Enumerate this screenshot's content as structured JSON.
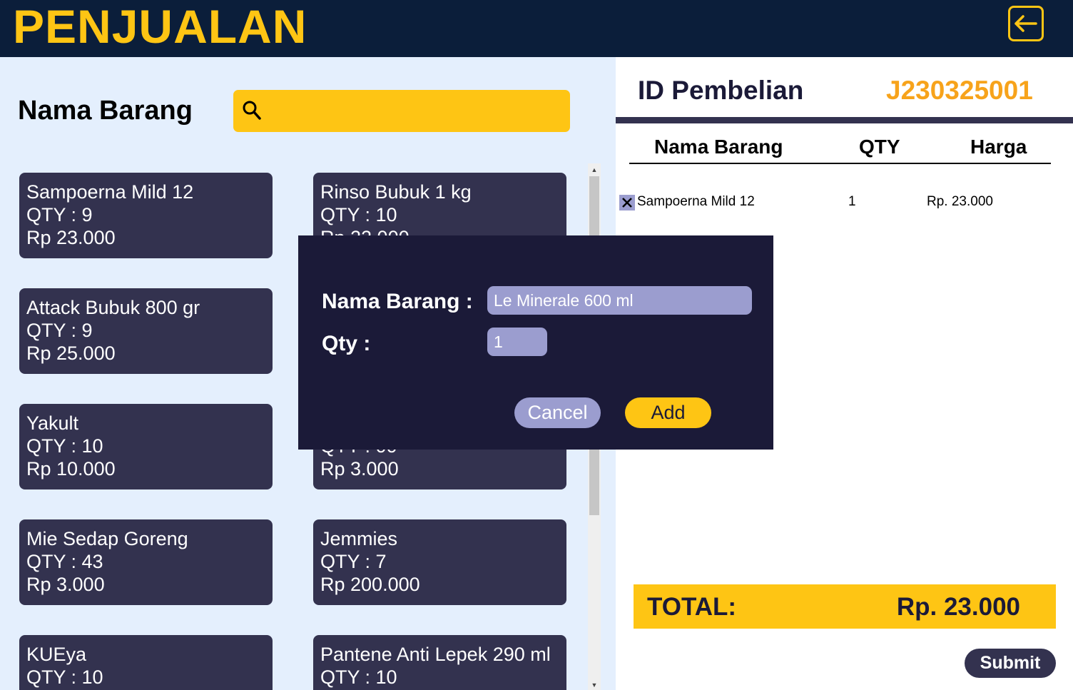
{
  "header": {
    "title": "PENJUALAN",
    "back_icon": "arrow-left-icon"
  },
  "search": {
    "label": "Nama Barang",
    "value": "",
    "placeholder": "",
    "icon": "search-icon"
  },
  "products": [
    {
      "name": "Sampoerna Mild 12",
      "qty": "QTY : 9",
      "price": "Rp 23.000"
    },
    {
      "name": "Rinso Bubuk 1 kg",
      "qty": "QTY : 10",
      "price": "Rp 22.000"
    },
    {
      "name": "Attack Bubuk 800 gr",
      "qty": "QTY : 9",
      "price": "Rp 25.000"
    },
    {
      "name": "",
      "qty": "",
      "price": ""
    },
    {
      "name": "Yakult",
      "qty": "QTY : 10",
      "price": "Rp 10.000"
    },
    {
      "name": "",
      "qty": "QTY : 00",
      "price": "Rp 3.000"
    },
    {
      "name": "Mie Sedap Goreng",
      "qty": "QTY : 43",
      "price": "Rp 3.000"
    },
    {
      "name": "Jemmies",
      "qty": "QTY : 7",
      "price": "Rp 200.000"
    },
    {
      "name": "KUEya",
      "qty": "QTY : 10",
      "price": ""
    },
    {
      "name": "Pantene Anti Lepek 290 ml",
      "qty": "QTY : 10",
      "price": ""
    }
  ],
  "purchase": {
    "id_label": "ID Pembelian",
    "id_value": "J230325001",
    "columns": {
      "name": "Nama Barang",
      "qty": "QTY",
      "price": "Harga"
    },
    "items": [
      {
        "name": "Sampoerna Mild 12",
        "qty": "1",
        "price": "Rp. 23.000"
      }
    ],
    "total_label": "TOTAL:",
    "total_value": "Rp. 23.000",
    "submit_label": "Submit"
  },
  "modal": {
    "name_label": "Nama Barang :",
    "name_value": "Le Minerale 600 ml",
    "qty_label": "Qty :",
    "qty_value": "1",
    "cancel_label": "Cancel",
    "add_label": "Add"
  },
  "colors": {
    "header_bg": "#0b1e3a",
    "accent_yellow": "#fec514",
    "card_bg": "#33324f",
    "modal_bg": "#1b1a38",
    "input_lavender": "#9b9dcf",
    "id_orange": "#f7a31b",
    "left_panel_bg": "#e4effd"
  }
}
